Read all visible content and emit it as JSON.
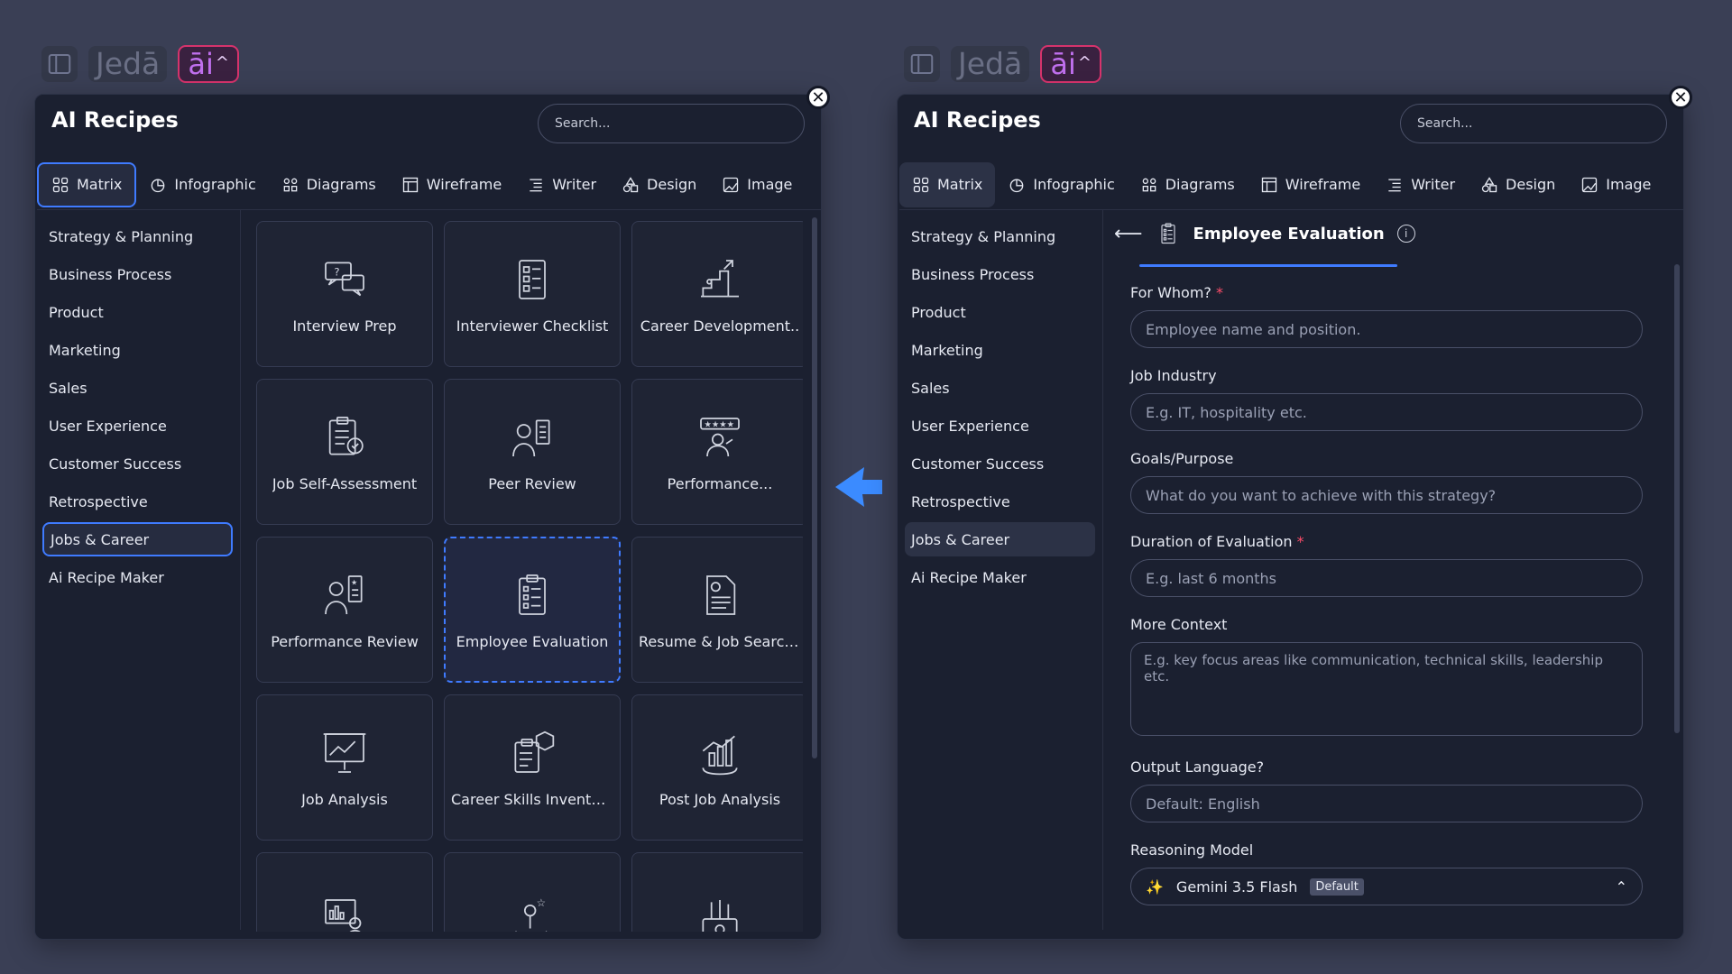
{
  "topbar": {
    "brand": "Jedā",
    "ai_label": "āi"
  },
  "left_panel": {
    "title": "AI Recipes",
    "search_placeholder": "Search...",
    "tabs": [
      {
        "label": "Matrix",
        "icon": "grid-icon"
      },
      {
        "label": "Infographic",
        "icon": "pie-chart-icon"
      },
      {
        "label": "Diagrams",
        "icon": "diagram-icon"
      },
      {
        "label": "Wireframe",
        "icon": "wireframe-icon"
      },
      {
        "label": "Writer",
        "icon": "text-icon"
      },
      {
        "label": "Design",
        "icon": "shapes-icon"
      },
      {
        "label": "Image",
        "icon": "image-icon"
      }
    ],
    "categories": [
      "Strategy & Planning",
      "Business Process",
      "Product",
      "Marketing",
      "Sales",
      "User Experience",
      "Customer Success",
      "Retrospective",
      "Jobs & Career",
      "Ai Recipe Maker"
    ],
    "selected_category": "Jobs & Career",
    "recipes": [
      {
        "label": "Interview Prep",
        "icon": "interview-chat-icon"
      },
      {
        "label": "Interviewer Checklist",
        "icon": "checklist-icon"
      },
      {
        "label": "Career Development..",
        "icon": "career-growth-icon"
      },
      {
        "label": "Job Self-Assessment",
        "icon": "clipboard-check-icon"
      },
      {
        "label": "Peer Review",
        "icon": "peer-review-icon"
      },
      {
        "label": "Performance...",
        "icon": "rating-stars-icon"
      },
      {
        "label": "Performance Review",
        "icon": "performance-review-icon"
      },
      {
        "label": "Employee Evaluation",
        "icon": "evaluation-clipboard-icon"
      },
      {
        "label": "Resume & Job Search..",
        "icon": "resume-icon"
      },
      {
        "label": "Job Analysis",
        "icon": "presentation-chart-icon"
      },
      {
        "label": "Career Skills Inventory",
        "icon": "skills-box-icon"
      },
      {
        "label": "Post Job Analysis",
        "icon": "bar-growth-icon"
      },
      {
        "label": "",
        "icon": "dashboard-people-icon"
      },
      {
        "label": "",
        "icon": "hand-star-icon"
      },
      {
        "label": "",
        "icon": "tools-box-icon"
      }
    ]
  },
  "right_panel": {
    "title": "AI Recipes",
    "search_placeholder": "Search...",
    "form": {
      "title": "Employee Evaluation",
      "info": "i",
      "fields": [
        {
          "label": "For Whom?",
          "required": true,
          "placeholder": "Employee name and position."
        },
        {
          "label": "Job Industry",
          "required": false,
          "placeholder": "E.g. IT, hospitality etc."
        },
        {
          "label": "Goals/Purpose",
          "required": false,
          "placeholder": "What do you want to achieve with this strategy?"
        },
        {
          "label": "Duration of Evaluation",
          "required": true,
          "placeholder": "E.g. last 6 months"
        }
      ],
      "more_context": {
        "label": "More Context",
        "placeholder": "E.g. key focus areas like communication, technical skills, leadership etc."
      },
      "output_language": {
        "label": "Output Language?",
        "placeholder": "Default: English"
      },
      "reasoning_model": {
        "label": "Reasoning Model",
        "value": "Gemini 3.5 Flash",
        "badge": "Default"
      }
    }
  },
  "colors": {
    "accent": "#3f7bff",
    "background": "#3a3f55",
    "panel": "#1b2030",
    "ai_border": "#d6336c",
    "required": "#ff4d6a"
  }
}
